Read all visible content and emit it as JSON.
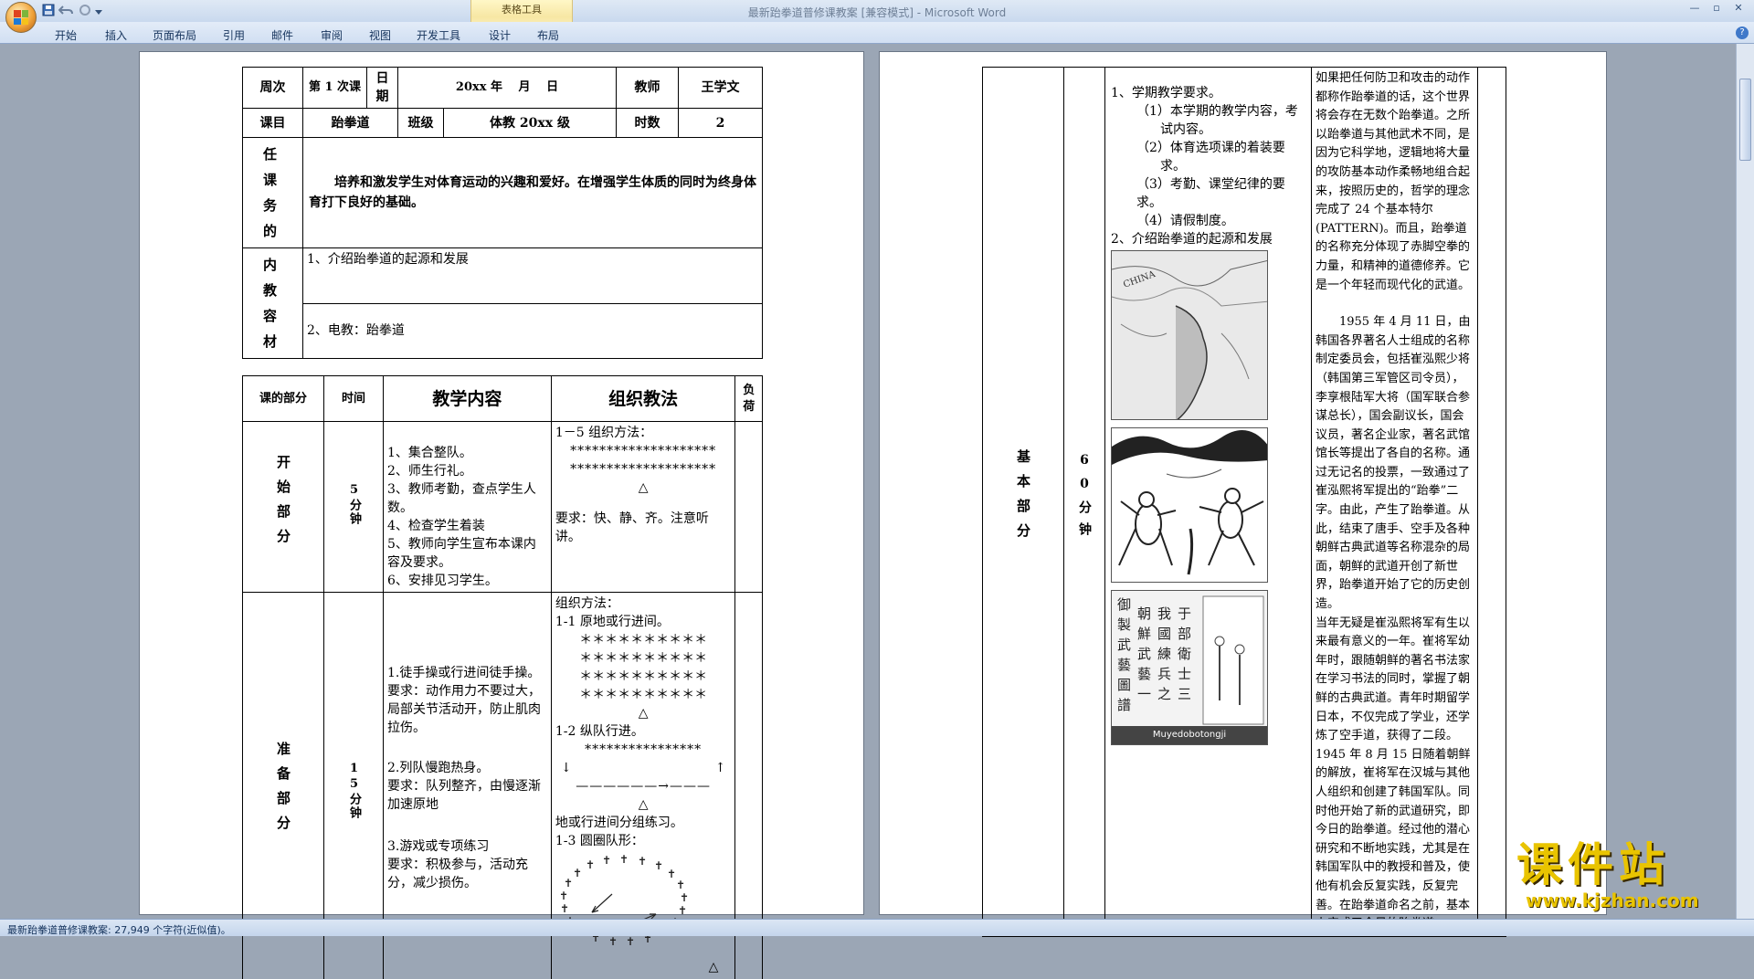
{
  "window": {
    "title": "最新跆拳道普修课教案 [兼容模式] - Microsoft Word",
    "contextual_group": "表格工具"
  },
  "ribbon": {
    "tabs": [
      "开始",
      "插入",
      "页面布局",
      "引用",
      "邮件",
      "审阅",
      "视图",
      "开发工具",
      "设计",
      "布局"
    ]
  },
  "status": {
    "text": "最新跆拳道普修课教案: 27,949 个字符(近似值)。"
  },
  "icons": {
    "office_button": "office-logo-icon",
    "save": "save-icon",
    "undo": "undo-icon",
    "redo": "redo-icon",
    "customize": "dropdown-icon",
    "help": "help-icon"
  },
  "left_page": {
    "header_table": {
      "week_label": "周次",
      "lesson_no": "第 1 次课",
      "date_label": "日期",
      "date_value": "20xx 年　 月　  日",
      "teacher_label": "教师",
      "teacher_value": "王学文",
      "subject_label": "课目",
      "subject_value": "跆拳道",
      "class_label": "班级",
      "class_value": "体教 20xx 级",
      "hours_label": "时数",
      "hours_value": "2",
      "task_label": "任课务的",
      "task_value": "培养和激发学生对体育运动的兴趣和爱好。在增强学生体质的同时为终身体育打下良好的基础。",
      "content_label": "内教容材",
      "content_1": "1、介绍跆拳道的起源和发展",
      "content_2": "2、电教：跆拳道"
    },
    "main_table": {
      "h_part": "课的部分",
      "h_time": "时间",
      "h_content": "教学内容",
      "h_method": "组织教法",
      "h_load": "负荷",
      "start": {
        "part": "开始部分",
        "time": "5分钟",
        "items": [
          "1、集合整队。",
          "2、师生行礼。",
          "3、教师考勤，查点学生人数。",
          "4、检查学生着装",
          "5、教师向学生宣布本课内容及要求。",
          "6、安排见习学生。"
        ],
        "method_title": "1－5 组织方法：",
        "pattern_row": "********************",
        "teacher_mark": "△",
        "requirement": "要求：快、静、齐。注意听讲。"
      },
      "prep": {
        "part": "准备部分",
        "time": "15分钟",
        "ex1": "1.徒手操或行进间徒手操。",
        "ex1_req": "要求：动作用力不要过大，局部关节活动开，防止肌肉拉伤。",
        "ex2": "2.列队慢跑热身。",
        "ex2_req": "要求：队列整齐，由慢逐渐加速原地",
        "ex3": "3.游戏或专项练习",
        "ex3_req": "要求：积极参与，活动充分，减少损伤。",
        "method_title": "组织方法：",
        "m1": "1-1 原地或行进间。",
        "star_row": "＊＊＊＊＊＊＊＊＊＊",
        "m2": "1-2 纵队行进。",
        "col_row": "****************",
        "run_line": "——————→———",
        "arrow_down": "↓",
        "arrow_up": "↑",
        "m3": "地或行进间分组练习。",
        "m4": "1-3 圆圈队形："
      }
    }
  },
  "right_page": {
    "part": "基本部分",
    "time": "60分钟",
    "requirements_title": "1、学期教学要求。",
    "req_items": [
      "（1）本学期的教学内容，考试内容。",
      "（2）体育选项课的着装要求。",
      "（3）考勤、课堂纪律的要求。",
      "（4）请假制度。"
    ],
    "origin_title": "2、介绍跆拳道的起源和发展",
    "image_caption": "Muyedobotongji",
    "text_1": "如果把任何防卫和攻击的动作都称作跆拳道的话，这个世界将会存在无数个跆拳道。之所以跆拳道与其他武术不同，是因为它科学地，逻辑地将大量的攻防基本动作柔畅地组合起来，按照历史的，哲学的理念完成了 24 个基本特尔(PATTERN)。而且，跆拳道的名称充分体现了赤脚空拳的力量，和精神的道德修养。它是一个年轻而现代化的武道。",
    "text_2": "1955 年 4 月 11 日，由韩国各界著名人士组成的名称制定委员会，包括崔泓熙少将（韩国第三军管区司令员），李享根陆军大将（国军联合参谋总长），国会副议长，国会议员，著名企业家，著名武馆馆长等提出了各自的名称。通过无记名的投票，一致通过了崔泓熙将军提出的“跆拳”二字。由此，产生了跆拳道。从此，结束了唐手、空手及各种朝鲜古典武道等名称混杂的局面，朝鲜的武道开创了新世界，跆拳道开始了它的历史创造。",
    "text_3": "当年无疑是崔泓熙将军有生以来最有意义的一年。崔将军幼年时，跟随朝鲜的著名书法家在学习书法的同时，掌握了朝鲜的古典武道。青年时期留学日本，不仅完成了学业，还学炼了空手道，获得了二段。1945 年 8 月 15 日随着朝鲜的解放，崔将军在汉城与其他人组织和创建了韩国军队。同时他开始了新的武道研究，即今日的跆拳道。经过他的潜心研究和不断地实践，尤其是在韩国军队中的教授和普及，使他有机会反复实践，反复完善。在跆拳道命名之前，基本上完成了今日的跆拳道。"
  },
  "watermark": {
    "brand": "课件站",
    "url": "www.kjzhan.com"
  },
  "colors": {
    "workspace": "#9ba6b5",
    "ribbon": "#d1dff2",
    "watermark": "#e9c400"
  }
}
